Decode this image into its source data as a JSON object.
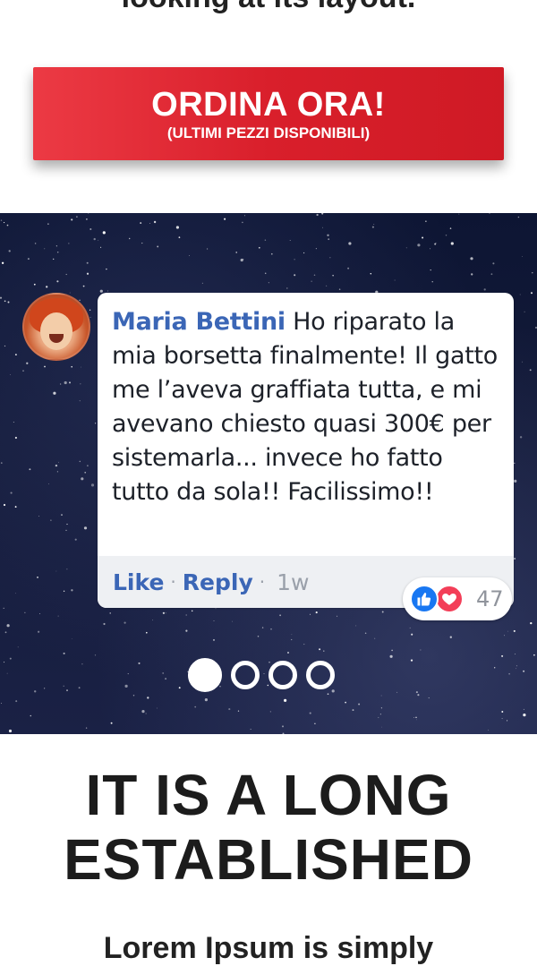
{
  "header": {
    "partial_text": "looking at its layout."
  },
  "cta": {
    "main_label": "ORDINA ORA!",
    "sub_label": "(ULTIMI PEZZI DISPONIBILI)",
    "color": "#e02832"
  },
  "testimonial": {
    "author": "Maria Bettini",
    "text": " Ho riparato la mia borsetta finalmente! Il gatto me l’aveva graffiata tutta, e mi avevano chiesto quasi 300€ per sistemarla... invece ho fatto tutto da sola!! Facilissimo!!",
    "actions": {
      "like": "Like",
      "reply": "Reply",
      "separator": "·",
      "time": "1w"
    },
    "reactions": {
      "icons": [
        "like-reaction-icon",
        "love-reaction-icon"
      ],
      "count": "47"
    }
  },
  "carousel": {
    "slide_count": 4,
    "active_index": 0
  },
  "section": {
    "headline": "IT IS A LONG\nESTABLISHED",
    "partial_body": "Lorem Ipsum is simply"
  }
}
